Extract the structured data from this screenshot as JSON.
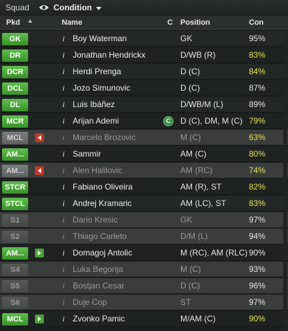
{
  "topbar": {
    "title": "Squad",
    "view_label": "Condition"
  },
  "columns": {
    "pkd": "Pkd",
    "name": "Name",
    "c": "C",
    "position": "Position",
    "con": "Con"
  },
  "rows": [
    {
      "pkd": "GK",
      "style": "green",
      "badge": "",
      "name": "Boy Waterman",
      "c": "",
      "position": "GK",
      "con": "95%",
      "con_color": "white",
      "bg": "dark",
      "dim": false
    },
    {
      "pkd": "DR",
      "style": "green",
      "badge": "",
      "name": "Jonathan Hendrickx",
      "c": "",
      "position": "D/WB (R)",
      "con": "83%",
      "con_color": "yellow",
      "bg": "alt",
      "dim": false
    },
    {
      "pkd": "DCR",
      "style": "green",
      "badge": "",
      "name": "Herdi Prenga",
      "c": "",
      "position": "D (C)",
      "con": "84%",
      "con_color": "yellow",
      "bg": "dark",
      "dim": false
    },
    {
      "pkd": "DCL",
      "style": "green",
      "badge": "",
      "name": "Jozo Simunovic",
      "c": "",
      "position": "D (C)",
      "con": "87%",
      "con_color": "white",
      "bg": "alt",
      "dim": false
    },
    {
      "pkd": "DL",
      "style": "green",
      "badge": "",
      "name": "Luis Ibáñez",
      "c": "",
      "position": "D/WB/M (L)",
      "con": "89%",
      "con_color": "white",
      "bg": "dark",
      "dim": false
    },
    {
      "pkd": "MCR",
      "style": "green",
      "badge": "",
      "name": "Arijan Ademi",
      "c": "C",
      "position": "D (C), DM, M (C)",
      "con": "79%",
      "con_color": "yellow",
      "bg": "alt",
      "dim": false
    },
    {
      "pkd": "MCL",
      "style": "grey",
      "badge": "red",
      "name": "Marcelo Brozovic",
      "c": "",
      "position": "M (C)",
      "con": "63%",
      "con_color": "yellow",
      "bg": "dim",
      "dim": true
    },
    {
      "pkd": "AM...",
      "style": "green",
      "badge": "",
      "name": "Sammir",
      "c": "",
      "position": "AM (C)",
      "con": "80%",
      "con_color": "yellow",
      "bg": "alt",
      "dim": false
    },
    {
      "pkd": "AM...",
      "style": "grey",
      "badge": "red",
      "name": "Alen Halilovic",
      "c": "",
      "position": "AM (RC)",
      "con": "74%",
      "con_color": "yellow",
      "bg": "dim",
      "dim": true
    },
    {
      "pkd": "STCR",
      "style": "green",
      "badge": "",
      "name": "Fabiano Oliveira",
      "c": "",
      "position": "AM (R), ST",
      "con": "82%",
      "con_color": "yellow",
      "bg": "alt",
      "dim": false
    },
    {
      "pkd": "STCL",
      "style": "green",
      "badge": "",
      "name": "Andrej Kramaric",
      "c": "",
      "position": "AM (LC), ST",
      "con": "83%",
      "con_color": "yellow",
      "bg": "dark",
      "dim": false
    },
    {
      "pkd": "S1",
      "style": "greyd",
      "badge": "",
      "name": "Dario Kresic",
      "c": "",
      "position": "GK",
      "con": "97%",
      "con_color": "white",
      "bg": "dim",
      "dim": true
    },
    {
      "pkd": "S2",
      "style": "greyd",
      "badge": "",
      "name": "Thiago Carleto",
      "c": "",
      "position": "D/M (L)",
      "con": "94%",
      "con_color": "white",
      "bg": "dim",
      "dim": true
    },
    {
      "pkd": "AM...",
      "style": "green",
      "badge": "green",
      "name": "Domagoj Antolic",
      "c": "",
      "position": "M (RC), AM (RLC)",
      "con": "90%",
      "con_color": "white",
      "bg": "alt",
      "dim": false
    },
    {
      "pkd": "S4",
      "style": "greyd",
      "badge": "",
      "name": "Luka Begonja",
      "c": "",
      "position": "M (C)",
      "con": "93%",
      "con_color": "white",
      "bg": "dim",
      "dim": true
    },
    {
      "pkd": "S5",
      "style": "greyd",
      "badge": "",
      "name": "Bostjan Cesar",
      "c": "",
      "position": "D (C)",
      "con": "96%",
      "con_color": "white",
      "bg": "dim",
      "dim": true
    },
    {
      "pkd": "S6",
      "style": "greyd",
      "badge": "",
      "name": "Duje Cop",
      "c": "",
      "position": "ST",
      "con": "97%",
      "con_color": "white",
      "bg": "dim",
      "dim": true
    },
    {
      "pkd": "MCL",
      "style": "green",
      "badge": "green",
      "name": "Zvonko Pamic",
      "c": "",
      "position": "M/AM (C)",
      "con": "90%",
      "con_color": "yellow",
      "bg": "alt",
      "dim": false
    }
  ]
}
